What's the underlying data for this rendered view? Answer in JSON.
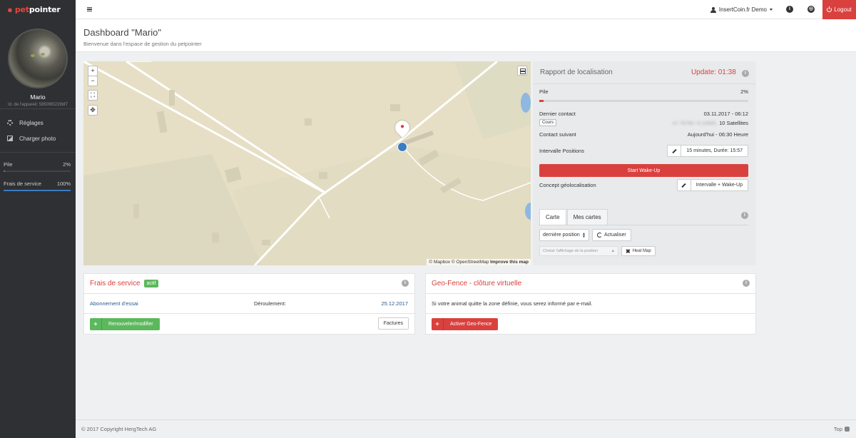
{
  "brand": {
    "pet": "pet",
    "pointer": "pointer"
  },
  "profile": {
    "name": "Mario",
    "device_id": "Id. de l'appareil: 5850f65229bf7"
  },
  "sidebar": {
    "menu": [
      {
        "label": "Réglages",
        "icon": "gear-icon"
      },
      {
        "label": "Charger photo",
        "icon": "photo-icon"
      }
    ],
    "stats": [
      {
        "label": "Pile",
        "value": "2%",
        "level": 0.02
      },
      {
        "label": "Frais de service",
        "value": "100%",
        "level": 1.0
      }
    ]
  },
  "topbar": {
    "user": "InsertCoin.fr Demo",
    "logout": "Logout"
  },
  "header": {
    "title": "Dashboard  \"Mario\"",
    "subtitle": "Bienvenue dans l'espace de gestion du petpointer"
  },
  "map": {
    "zoom_in": "+",
    "zoom_out": "−",
    "attribution_a": "© Mapbox © OpenStreetMap",
    "attribution_b": "Improve this map"
  },
  "report": {
    "title": "Rapport de localisation",
    "update": "Update: 01:38",
    "pile_label": "Pile",
    "pile_value": "2%",
    "pile_level": 0.02,
    "last_contact_label": "Dernier contact",
    "last_contact_value": "03.11.2017  -  06:12",
    "cours": "Cours",
    "coords_blurred": "47.78768 / 8.10845,",
    "satellites": "10 Satellites",
    "next_contact_label": "Contact suivant",
    "next_contact_value": "Aujourd'hui  -  06:30 Heure",
    "interval_label": "Intervalle Positions",
    "interval_value": "15 minutes, Durée: 15:57",
    "wake_btn": "Start Wake-Up",
    "concept_label": "Concept géolocalisation",
    "concept_value": "Intervalle + Wake-Up",
    "tabs": [
      "Carte",
      "Mes cartes"
    ],
    "select_value": "dernière position",
    "refresh_btn": "Actualiser",
    "choose_placeholder": "Choisir l'affichage de la position",
    "heatmap_btn": "Heat Map"
  },
  "service_card": {
    "title": "Frais de service",
    "badge": "actif",
    "plan": "Abonnement d'essai",
    "expiry_label": "Déroulement:",
    "expiry_value": "25.12.2017",
    "renew_btn": "Renouveler/modifier",
    "invoices_btn": "Factures"
  },
  "geofence_card": {
    "title": "Geo-Fence - clôture virtuelle",
    "text": "Si votre animal quitte la zone définie, vous serez informé par e-mail.",
    "activate_btn": "Activer Geo-Fence"
  },
  "footer": {
    "copyright": "© 2017 Copyright HergTech AG",
    "top": "Top"
  },
  "colors": {
    "accent_red": "#d9413e",
    "green": "#5cb85c",
    "sidebar": "#2f3033",
    "blue": "#3a7cc1"
  }
}
